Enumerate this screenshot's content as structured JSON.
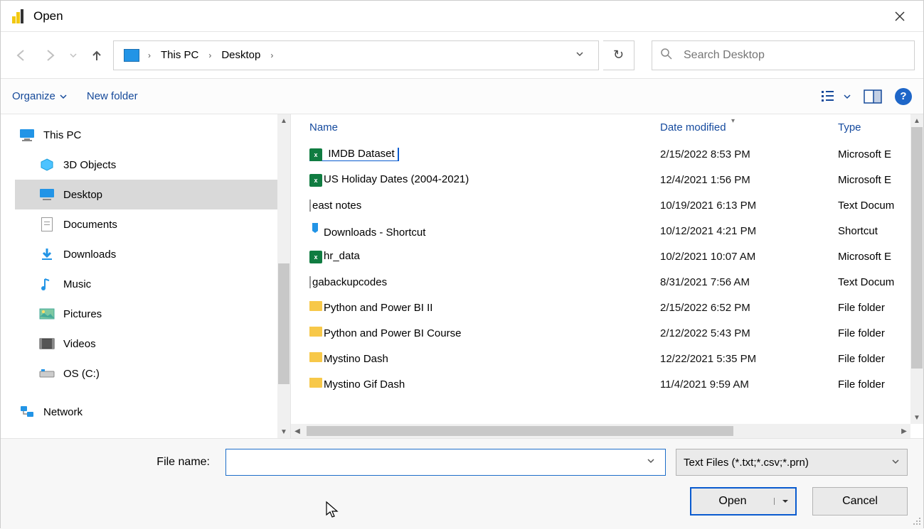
{
  "window": {
    "title": "Open"
  },
  "breadcrumb": {
    "seg1": "This PC",
    "seg2": "Desktop"
  },
  "search": {
    "placeholder": "Search Desktop"
  },
  "toolbar": {
    "organize": "Organize",
    "newfolder": "New folder"
  },
  "sidebar": {
    "thispc": "This PC",
    "objects3d": "3D Objects",
    "desktop": "Desktop",
    "documents": "Documents",
    "downloads": "Downloads",
    "music": "Music",
    "pictures": "Pictures",
    "videos": "Videos",
    "osc": "OS (C:)",
    "network": "Network"
  },
  "columns": {
    "name": "Name",
    "date": "Date modified",
    "type": "Type"
  },
  "files": [
    {
      "name": "IMDB Dataset",
      "date": "2/15/2022 8:53 PM",
      "type": "Microsoft E",
      "icon": "excel",
      "selected": true
    },
    {
      "name": "US Holiday Dates (2004-2021)",
      "date": "12/4/2021 1:56 PM",
      "type": "Microsoft E",
      "icon": "excel"
    },
    {
      "name": "east notes",
      "date": "10/19/2021 6:13 PM",
      "type": "Text Docum",
      "icon": "txt"
    },
    {
      "name": "Downloads - Shortcut",
      "date": "10/12/2021 4:21 PM",
      "type": "Shortcut",
      "icon": "shortcut"
    },
    {
      "name": "hr_data",
      "date": "10/2/2021 10:07 AM",
      "type": "Microsoft E",
      "icon": "excel"
    },
    {
      "name": "gabackupcodes",
      "date": "8/31/2021 7:56 AM",
      "type": "Text Docum",
      "icon": "txt"
    },
    {
      "name": "Python and Power BI II",
      "date": "2/15/2022 6:52 PM",
      "type": "File folder",
      "icon": "folder"
    },
    {
      "name": "Python and Power BI Course",
      "date": "2/12/2022 5:43 PM",
      "type": "File folder",
      "icon": "folder"
    },
    {
      "name": "Mystino Dash",
      "date": "12/22/2021 5:35 PM",
      "type": "File folder",
      "icon": "folder"
    },
    {
      "name": "Mystino Gif Dash",
      "date": "11/4/2021 9:59 AM",
      "type": "File folder",
      "icon": "folder"
    }
  ],
  "footer": {
    "filename_label": "File name:",
    "filename_value": "",
    "filter": "Text Files (*.txt;*.csv;*.prn)",
    "open": "Open",
    "cancel": "Cancel"
  }
}
